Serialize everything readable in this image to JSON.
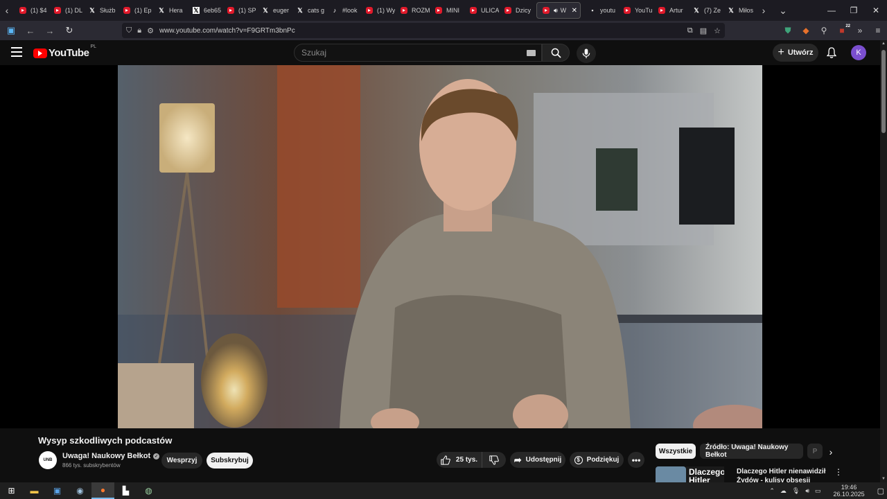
{
  "browser": {
    "tabs": [
      {
        "label": "(1) $4",
        "favicon": "youtube"
      },
      {
        "label": "(1) DL",
        "favicon": "youtube"
      },
      {
        "label": "Służb",
        "favicon": "x"
      },
      {
        "label": "(1) Ep",
        "favicon": "youtube"
      },
      {
        "label": "Hera",
        "favicon": "x"
      },
      {
        "label": "6eb65",
        "favicon": "x-box"
      },
      {
        "label": "(1) SP",
        "favicon": "youtube"
      },
      {
        "label": "euger",
        "favicon": "x"
      },
      {
        "label": "cats g",
        "favicon": "x"
      },
      {
        "label": "#look",
        "favicon": "tiktok"
      },
      {
        "label": "(1) Wy",
        "favicon": "youtube"
      },
      {
        "label": "ROZM",
        "favicon": "youtube"
      },
      {
        "label": "MINI",
        "favicon": "youtube"
      },
      {
        "label": "ULICA",
        "favicon": "youtube"
      },
      {
        "label": "Dzicy",
        "favicon": "youtube"
      },
      {
        "label": "W",
        "favicon": "youtube",
        "active": true
      },
      {
        "label": "youtu",
        "favicon": "generic"
      },
      {
        "label": "YouTu",
        "favicon": "youtube"
      },
      {
        "label": "Artur",
        "favicon": "youtube"
      },
      {
        "label": "(7) Ze",
        "favicon": "x"
      },
      {
        "label": "Miłos",
        "favicon": "x"
      }
    ],
    "url": "www.youtube.com/watch?v=F9GRTm3bnPc",
    "extension_badge": "22"
  },
  "youtube": {
    "logo_text": "YouTube",
    "country_code": "PL",
    "search_placeholder": "Szukaj",
    "create_label": "Utwórz",
    "avatar_letter": "K"
  },
  "video": {
    "title": "Wysyp szkodliwych podcastów",
    "channel_name": "Uwaga! Naukowy Bełkot",
    "channel_avatar_text": "UNB",
    "subscribers": "866 tys. subskrybentów",
    "support_label": "Wesprzyj",
    "subscribe_label": "Subskrybuj",
    "likes": "25 tys.",
    "share_label": "Udostępnij",
    "thanks_label": "Podziękuj"
  },
  "sidebar": {
    "chips": [
      "Wszystkie",
      "Źródło: Uwaga! Naukowy Bełkot",
      "P"
    ],
    "related": {
      "thumb_text": "Dlaczego Hitler",
      "title": "Dlaczego Hitler nienawidził Żydów - kulisy obsesji"
    }
  },
  "taskbar": {
    "time": "19:46",
    "date": "26.10.2025"
  },
  "colors": {
    "accent": "#ff0000",
    "avatar": "#7b4fcf",
    "background": "#0f0f0f"
  }
}
